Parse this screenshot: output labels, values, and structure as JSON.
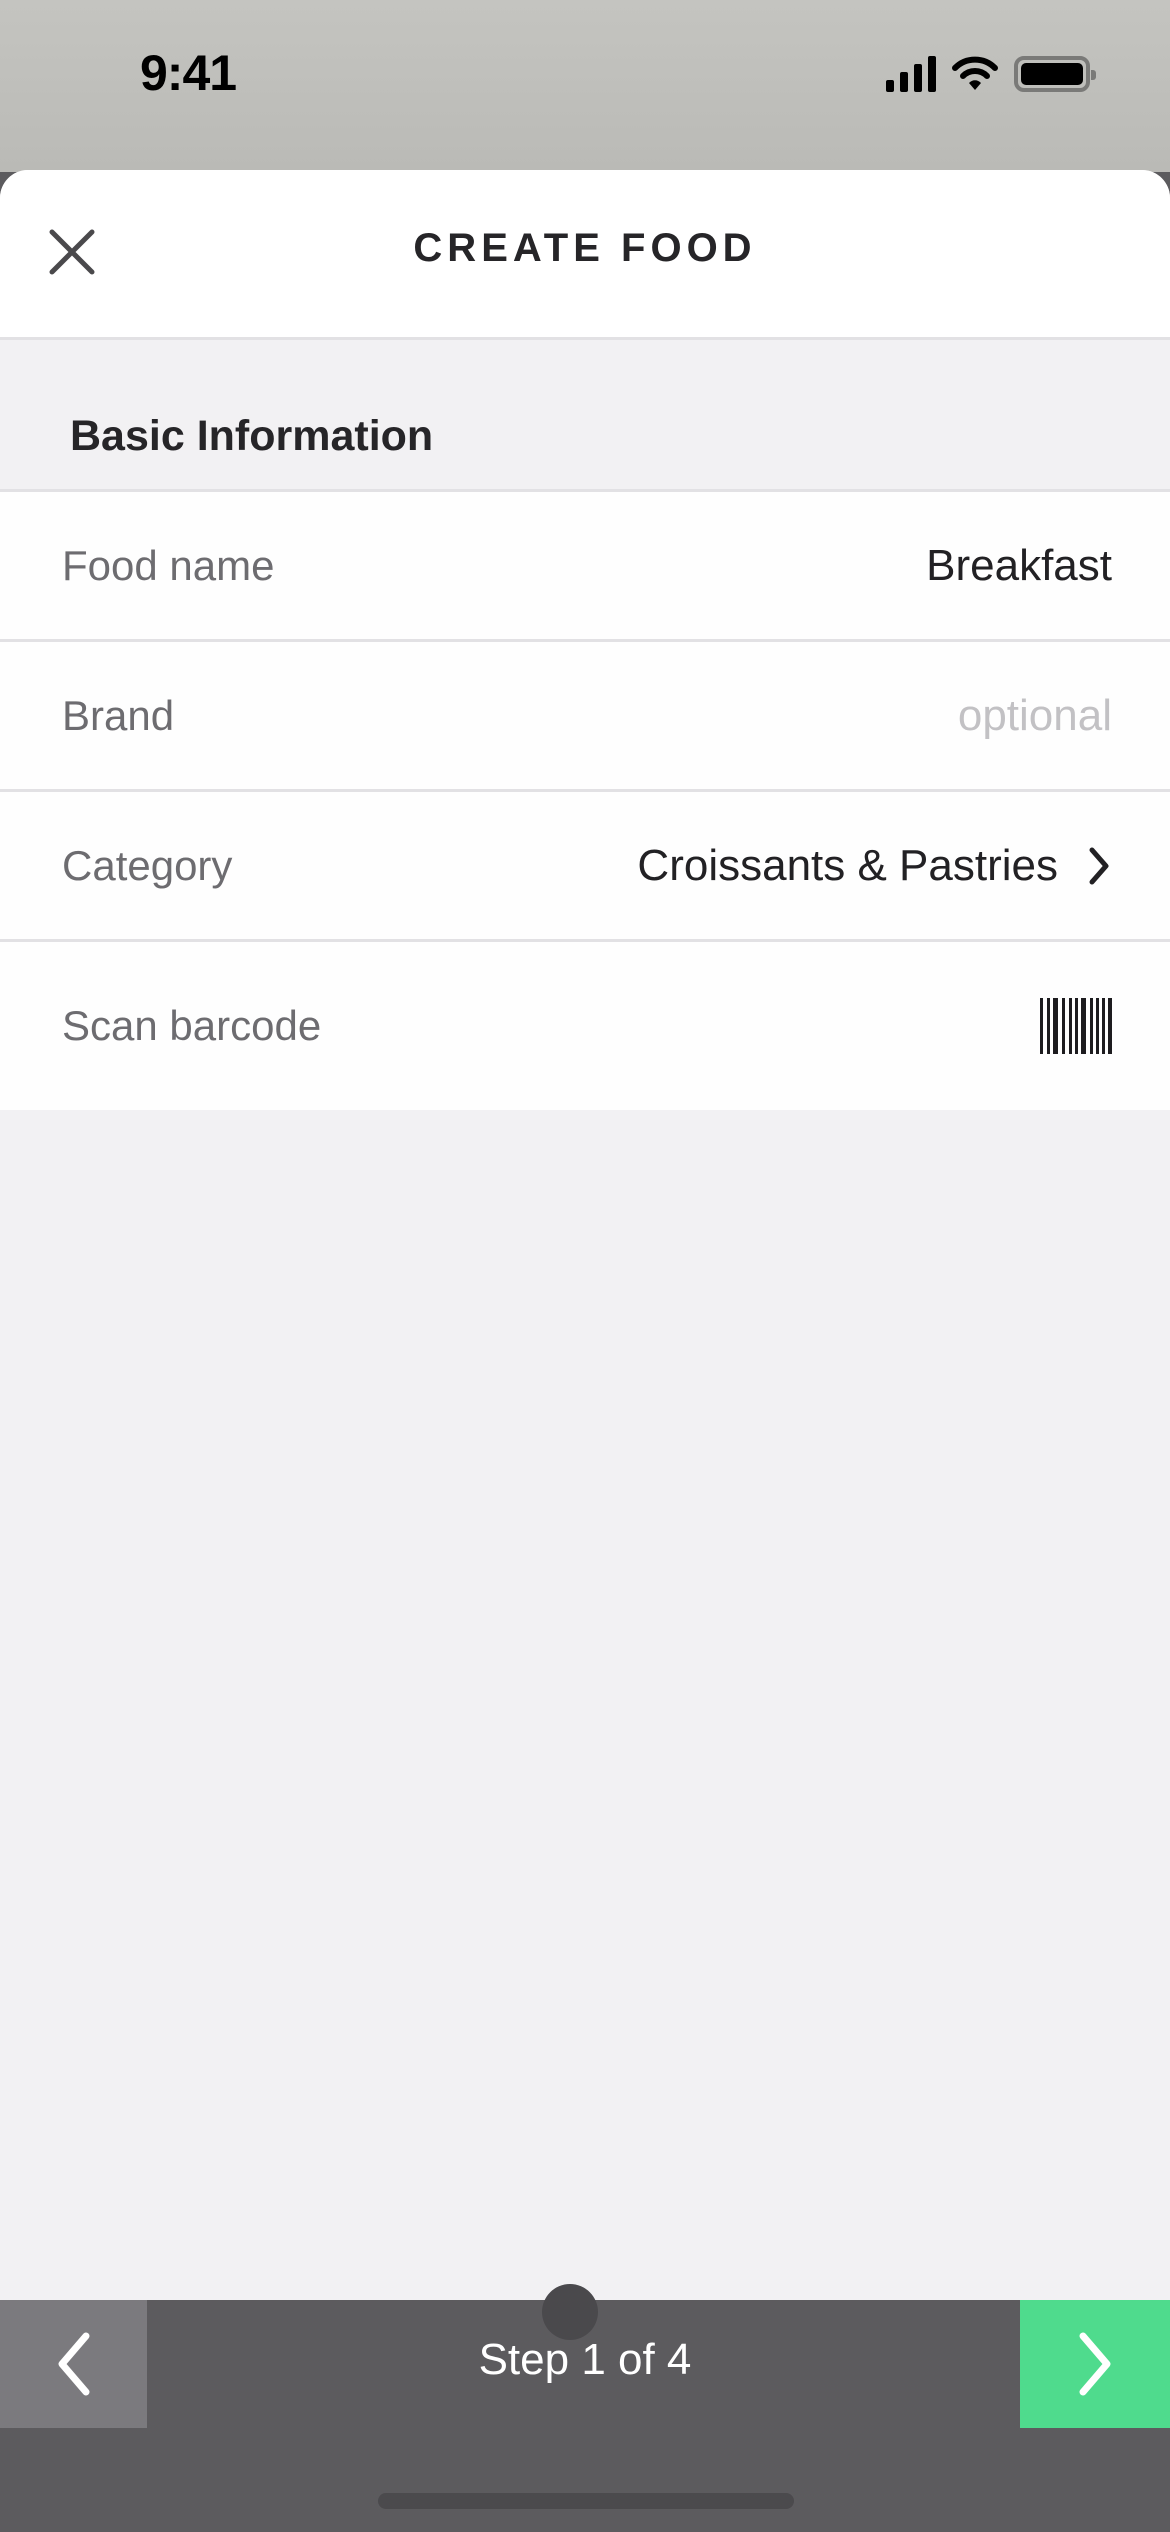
{
  "status_bar": {
    "time": "9:41",
    "icons": [
      "cellular-signal-icon",
      "wifi-icon",
      "battery-icon"
    ]
  },
  "header": {
    "title": "CREATE FOOD",
    "close_icon": "close-icon"
  },
  "section": {
    "title": "Basic Information"
  },
  "fields": [
    {
      "label": "Food name",
      "value": "Breakfast",
      "placeholder": ""
    },
    {
      "label": "Brand",
      "value": "",
      "placeholder": "optional"
    },
    {
      "label": "Category",
      "value": "Croissants & Pastries",
      "icon": "chevron-right-icon"
    },
    {
      "label": "Scan barcode",
      "icon": "barcode-icon"
    }
  ],
  "footer": {
    "step_label": "Step 1 of 4",
    "prev_icon": "chevron-left-icon",
    "next_icon": "chevron-right-icon",
    "next_color": "#4fdb8d"
  }
}
